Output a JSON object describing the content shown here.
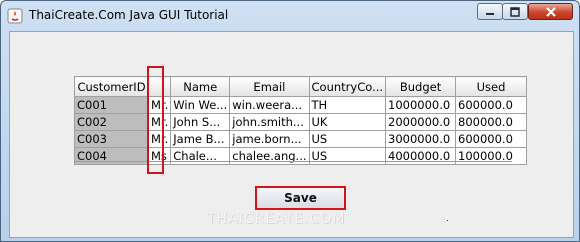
{
  "window": {
    "title": "ThaiCreate.Com Java GUI Tutorial",
    "icon": "java-icon"
  },
  "titlebar_buttons": {
    "minimize": "minimize-icon",
    "maximize": "maximize-icon",
    "close": "close-icon"
  },
  "table": {
    "columns": [
      "CustomerID",
      "",
      "Name",
      "Email",
      "CountryCo...",
      "Budget",
      "Used"
    ],
    "rows": [
      [
        "C001",
        "Mr.",
        "Win We...",
        "win.weera...",
        "TH",
        "1000000.0",
        "600000.0"
      ],
      [
        "C002",
        "Mr.",
        "John S...",
        "john.smith...",
        "UK",
        "2000000.0",
        "800000.0"
      ],
      [
        "C003",
        "Mr.",
        "Jame B...",
        "jame.born...",
        "US",
        "3000000.0",
        "600000.0"
      ],
      [
        "C004",
        "Ms",
        "Chale...",
        "chalee.ang...",
        "US",
        "4000000.0",
        "100000.0"
      ]
    ]
  },
  "save_button": {
    "label": "Save"
  },
  "watermark": "THAICREATE.COM",
  "colors": {
    "highlight": "#d2141c",
    "id_cell": "#bdbdbd",
    "panel": "#eeeeee",
    "titlebar": "#b9d1ea"
  }
}
